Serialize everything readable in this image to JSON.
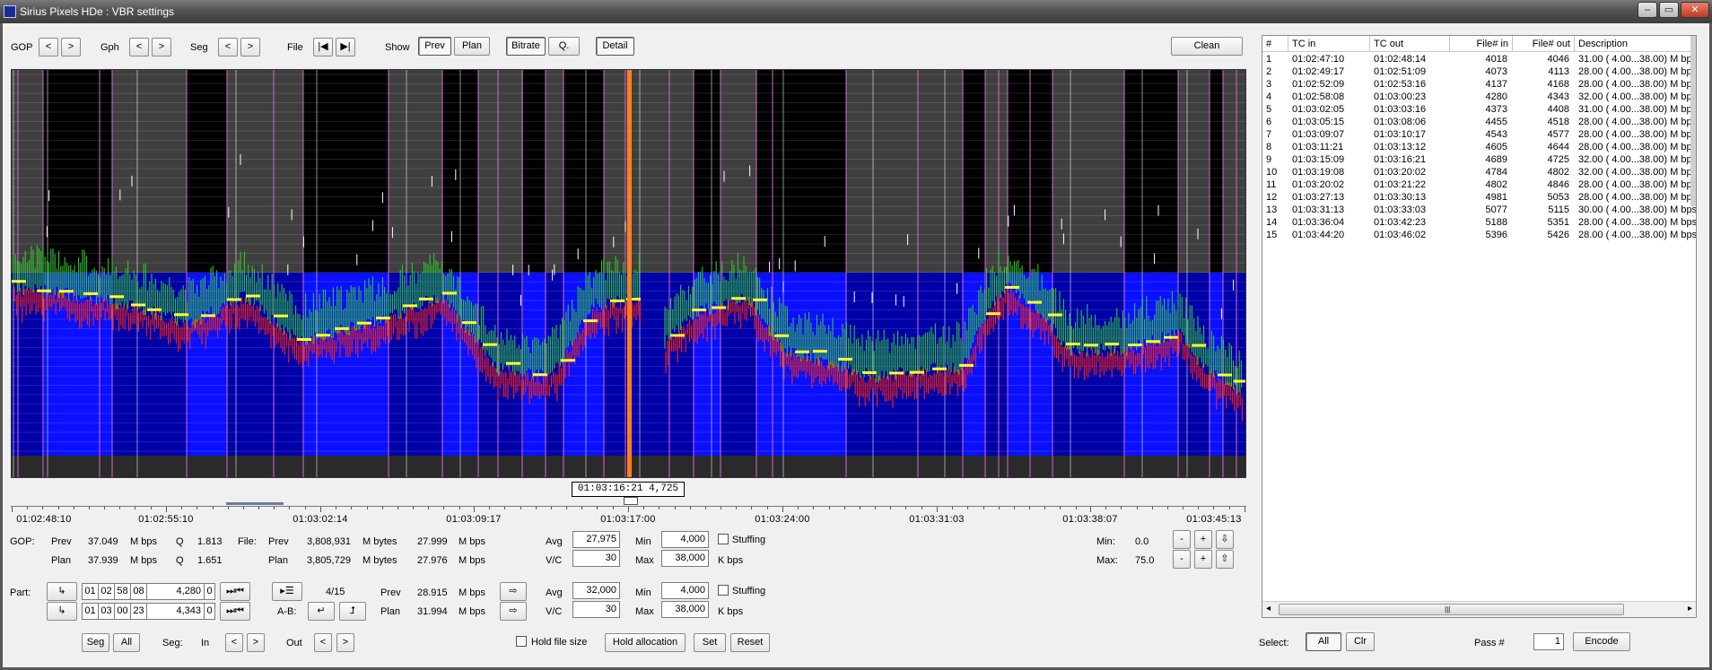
{
  "window": {
    "title": "Sirius Pixels HDe : VBR settings"
  },
  "toolbar": {
    "gop_label": "GOP",
    "gph_label": "Gph",
    "seg_label": "Seg",
    "file_label": "File",
    "show_label": "Show",
    "prev_arrow": "<",
    "next_arrow": ">",
    "first_file": "|◀",
    "last_file": "▶|",
    "prev_btn": "Prev",
    "plan_btn": "Plan",
    "bitrate_btn": "Bitrate",
    "q_btn": "Q.",
    "detail_btn": "Detail",
    "clean_btn": "Clean"
  },
  "graph": {
    "cursor_timecode": "01:03:16:21  4,725",
    "time_labels": [
      "01:02:48:10",
      "01:02:55:10",
      "01:03:02:14",
      "01:03:09:17",
      "01:03:17:00",
      "01:03:24:00",
      "01:03:31:03",
      "01:03:38:07",
      "01:03:45:13"
    ],
    "colors": {
      "background": "#000000",
      "segment_gray": "#3f3f3f",
      "band": "#0a10ff",
      "band_dark": "#0000a8",
      "cursor": "#ff7f1f",
      "gop_marker": "#d26ad2",
      "bitrate": "#2ec42e",
      "plan": "#ff2200",
      "level": "#ffff30"
    }
  },
  "gop": {
    "label": "GOP:",
    "prev_label": "Prev",
    "prev_mbps": "37.049",
    "plan_label": "Plan",
    "plan_mbps": "37.939",
    "unit_mbps": "M bps",
    "q_label": "Q",
    "prev_q": "1.813",
    "plan_q": "1.651"
  },
  "file": {
    "label": "File:",
    "prev_label": "Prev",
    "prev_bytes": "3,808,931",
    "plan_label": "Plan",
    "plan_bytes": "3,805,729",
    "unit_mbytes": "M bytes",
    "prev_mbps": "27.999",
    "plan_mbps": "27.976",
    "unit_mbps": "M bps"
  },
  "rates1": {
    "avg_label": "Avg",
    "avg": "27,975",
    "vc_label": "V/C",
    "vc": "30",
    "min_label": "Min",
    "min": "4,000",
    "max_label": "Max",
    "max": "38,000",
    "unit": "K bps",
    "stuffing_label": "Stuffing"
  },
  "scale": {
    "min_label": "Min:",
    "min_value": "0.0",
    "max_label": "Max:",
    "max_value": "75.0",
    "minus": "-",
    "plus": "+",
    "down": "⇩",
    "up": "⇧"
  },
  "part": {
    "label": "Part:",
    "jump_icon": "↳",
    "in_tc": [
      "01",
      "02",
      "58",
      "08"
    ],
    "in_frame": "4,280",
    "in_flag": "0",
    "out_tc": [
      "01",
      "03",
      "00",
      "23"
    ],
    "out_frame": "4,343",
    "out_flag": "0",
    "skip_icon": "⏭⏮",
    "list_icon": "▸☰",
    "index": "4/15",
    "ab_label": "A-B:",
    "ab_left": "↵",
    "ab_right": "⮥",
    "prev_label": "Prev",
    "prev_mbps": "28.915",
    "plan_label": "Plan",
    "plan_mbps": "31.994",
    "unit_mbps": "M bps",
    "arrow": "⇨"
  },
  "rates2": {
    "avg_label": "Avg",
    "avg": "32,000",
    "vc_label": "V/C",
    "vc": "30",
    "min_label": "Min",
    "min": "4,000",
    "max_label": "Max",
    "max": "38,000",
    "unit": "K bps",
    "stuffing_label": "Stuffing"
  },
  "bottom": {
    "seg_btn": "Seg",
    "all_btn": "All",
    "seg_label": "Seg:",
    "in_label": "In",
    "out_label": "Out",
    "hold_file_size": "Hold file size",
    "hold_allocation": "Hold allocation",
    "set_btn": "Set",
    "reset_btn": "Reset",
    "select_label": "Select:",
    "all_select_btn": "All",
    "clr_btn": "Clr",
    "pass_label": "Pass #",
    "pass_value": "1",
    "encode_btn": "Encode"
  },
  "table": {
    "headers": [
      "#",
      "TC in",
      "TC out",
      "File# in",
      "File# out",
      "Description"
    ],
    "rows": [
      [
        "1",
        "01:02:47:10",
        "01:02:48:14",
        "4018",
        "4046",
        "31.00 ( 4.00...38.00) M bps"
      ],
      [
        "2",
        "01:02:49:17",
        "01:02:51:09",
        "4073",
        "4113",
        "28.00 ( 4.00...38.00) M bps"
      ],
      [
        "3",
        "01:02:52:09",
        "01:02:53:16",
        "4137",
        "4168",
        "28.00 ( 4.00...38.00) M bps"
      ],
      [
        "4",
        "01:02:58:08",
        "01:03:00:23",
        "4280",
        "4343",
        "32.00 ( 4.00...38.00) M bps"
      ],
      [
        "5",
        "01:03:02:05",
        "01:03:03:16",
        "4373",
        "4408",
        "31.00 ( 4.00...38.00) M bps"
      ],
      [
        "6",
        "01:03:05:15",
        "01:03:08:06",
        "4455",
        "4518",
        "28.00 ( 4.00...38.00) M bps"
      ],
      [
        "7",
        "01:03:09:07",
        "01:03:10:17",
        "4543",
        "4577",
        "28.00 ( 4.00...38.00) M bps"
      ],
      [
        "8",
        "01:03:11:21",
        "01:03:13:12",
        "4605",
        "4644",
        "28.00 ( 4.00...38.00) M bps"
      ],
      [
        "9",
        "01:03:15:09",
        "01:03:16:21",
        "4689",
        "4725",
        "32.00 ( 4.00...38.00) M bps"
      ],
      [
        "10",
        "01:03:19:08",
        "01:03:20:02",
        "4784",
        "4802",
        "32.00 ( 4.00...38.00) M bps"
      ],
      [
        "11",
        "01:03:20:02",
        "01:03:21:22",
        "4802",
        "4846",
        "28.00 ( 4.00...38.00) M bps"
      ],
      [
        "12",
        "01:03:27:13",
        "01:03:30:13",
        "4981",
        "5053",
        "28.00 ( 4.00...38.00) M bps"
      ],
      [
        "13",
        "01:03:31:13",
        "01:03:33:03",
        "5077",
        "5115",
        "30.00 ( 4.00...38.00) M bps"
      ],
      [
        "14",
        "01:03:36:04",
        "01:03:42:23",
        "5188",
        "5351",
        "28.00 ( 4.00...38.00) M bps"
      ],
      [
        "15",
        "01:03:44:20",
        "01:03:46:02",
        "5396",
        "5426",
        "28.00 ( 4.00...38.00) M bps"
      ]
    ],
    "scroll_grip": "|||",
    "scroll_left": "◂",
    "scroll_right": "▸"
  }
}
